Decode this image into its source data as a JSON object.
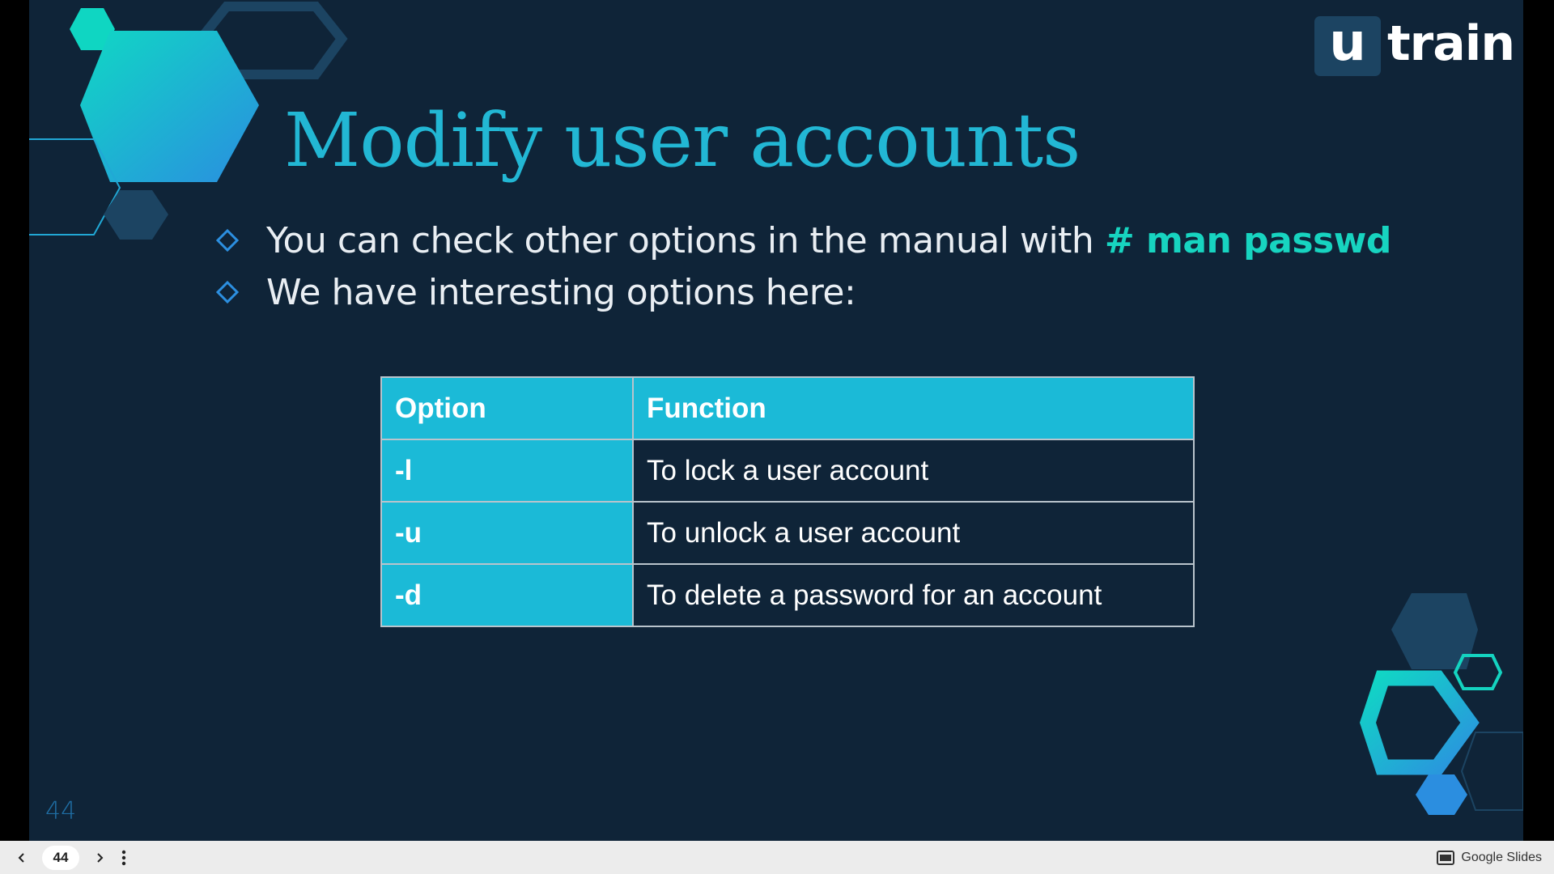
{
  "slide": {
    "logo": {
      "box_letter": "u",
      "text": "train"
    },
    "title": "Modify user accounts",
    "bullets": [
      {
        "text": "You can check other options in the manual with ",
        "command": "# man passwd"
      },
      {
        "text": "We have interesting options here:",
        "command": ""
      }
    ],
    "table": {
      "headers": [
        "Option",
        "Function"
      ],
      "rows": [
        {
          "option": "-l",
          "function": "To lock a user account"
        },
        {
          "option": "-u",
          "function": "To unlock a user account"
        },
        {
          "option": "-d",
          "function": "To delete a password for an account"
        }
      ]
    },
    "page_number": "44"
  },
  "footer": {
    "current_page": "44",
    "prev_icon": "chevron-left-icon",
    "next_icon": "chevron-right-icon",
    "menu_icon": "more-vertical-icon",
    "brand_icon": "presentation-icon",
    "brand": "Google Slides"
  },
  "colors": {
    "slide_bg": "#0f2438",
    "accent_cyan": "#22b7d4",
    "command_teal": "#17d4c0",
    "table_header": "#1bbad7",
    "hex_navy": "#1c4462"
  }
}
